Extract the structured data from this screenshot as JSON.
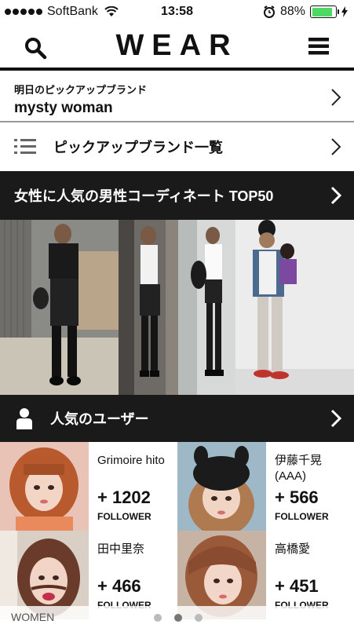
{
  "status": {
    "carrier": "SoftBank",
    "time": "13:58",
    "battery": "88%",
    "battery_level": 0.88
  },
  "header": {
    "logo": "WEAR"
  },
  "pickup": {
    "subtitle": "明日のピックアップブランド",
    "brand": "mysty woman"
  },
  "brand_list": {
    "label": "ピックアップブランド一覧"
  },
  "top50": {
    "label": "女性に人気の男性コーディネート TOP50"
  },
  "popular_users": {
    "label": "人気のユーザー",
    "users": [
      {
        "name": "Grimoire hito",
        "count": "+ 1202",
        "follower_label": "FOLLOWER"
      },
      {
        "name": "伊藤千晃 (AAA)",
        "count": "+ 566",
        "follower_label": "FOLLOWER"
      },
      {
        "name": "田中里奈",
        "count": "+ 466",
        "follower_label": "FOLLOWER"
      },
      {
        "name": "高橋愛",
        "count": "+ 451",
        "follower_label": "FOLLOWER"
      }
    ]
  },
  "footer": {
    "tab": "WOMEN",
    "page_count": 3,
    "active_page": 2
  },
  "colors": {
    "dark_bar": "#1a1a1a",
    "battery": "#4cd964"
  }
}
